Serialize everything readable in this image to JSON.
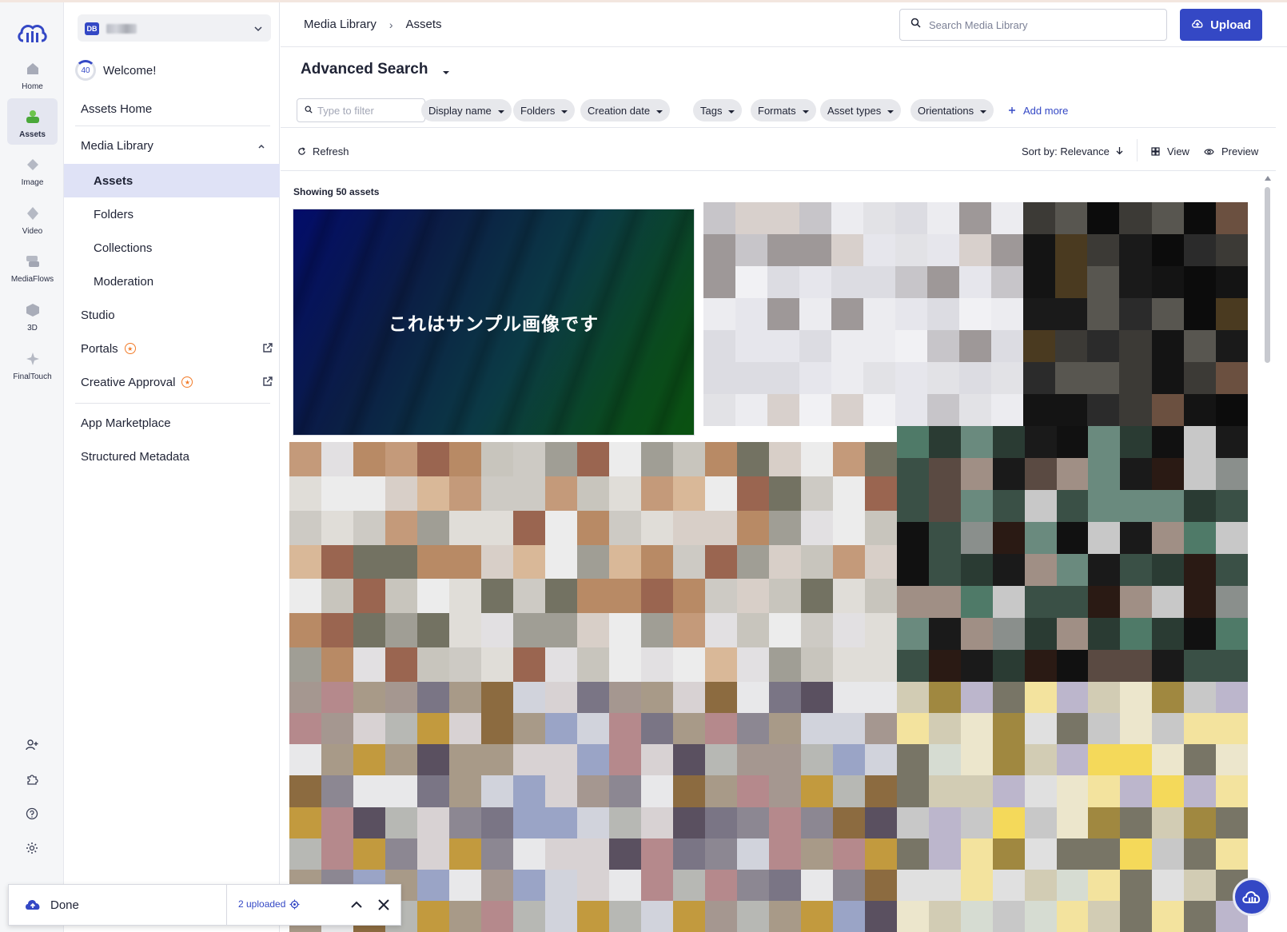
{
  "rail": {
    "items": [
      {
        "label": "Home",
        "icon": "home-icon"
      },
      {
        "label": "Assets",
        "icon": "assets-icon"
      },
      {
        "label": "Image",
        "icon": "image-icon"
      },
      {
        "label": "Video",
        "icon": "video-icon"
      },
      {
        "label": "MediaFlows",
        "icon": "mediaflows-icon"
      },
      {
        "label": "3D",
        "icon": "3d-icon"
      },
      {
        "label": "FinalTouch",
        "icon": "finaltouch-icon"
      }
    ],
    "tools": [
      "add-user-icon",
      "puzzle-icon",
      "help-icon",
      "settings-icon"
    ]
  },
  "nav": {
    "account_initials": "DB",
    "welcome_progress": "40",
    "welcome_text": "Welcome!",
    "assets_home": "Assets Home",
    "media_library": "Media Library",
    "assets": "Assets",
    "folders": "Folders",
    "collections": "Collections",
    "moderation": "Moderation",
    "studio": "Studio",
    "portals": "Portals",
    "creative_approval": "Creative Approval",
    "app_marketplace": "App Marketplace",
    "structured_metadata": "Structured Metadata"
  },
  "header": {
    "breadcrumb": [
      "Media Library",
      "Assets"
    ],
    "search_placeholder": "Search Media Library",
    "upload_label": "Upload"
  },
  "advanced": {
    "title": "Advanced Search",
    "filter_placeholder": "Type to filter",
    "chips": [
      "Display name",
      "Folders",
      "Creation date",
      "Tags",
      "Formats",
      "Asset types",
      "Orientations"
    ],
    "add_more": "Add more"
  },
  "toolbar": {
    "refresh": "Refresh",
    "sort_by": "Sort by: Relevance",
    "view": "View",
    "preview": "Preview"
  },
  "results": {
    "showing": "Showing 50 assets",
    "featured_text": "これはサンプル画像です"
  },
  "toast": {
    "status": "Done",
    "count": "2 uploaded"
  },
  "colors": {
    "accent": "#3448c5",
    "badge": "#f27b28"
  }
}
